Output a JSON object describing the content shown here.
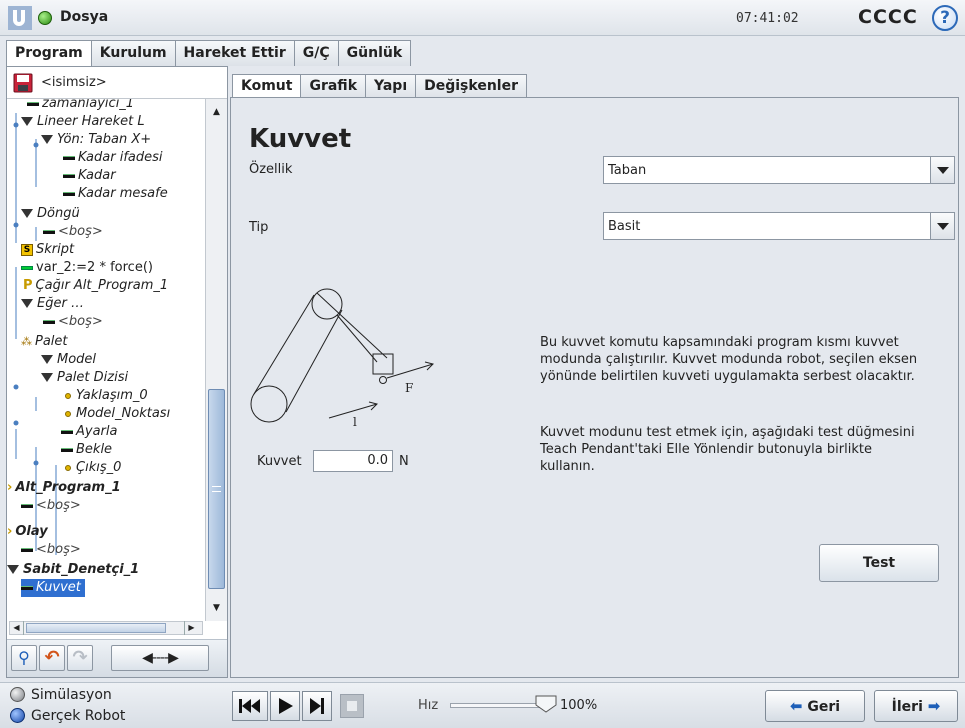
{
  "header": {
    "app_title": "Dosya",
    "clock": "07:41:02",
    "robot_name": "CCCC",
    "help_symbol": "?"
  },
  "main_tabs": [
    {
      "label": "Program",
      "active": true
    },
    {
      "label": "Kurulum",
      "active": false
    },
    {
      "label": "Hareket Ettir",
      "active": false
    },
    {
      "label": "G/Ç",
      "active": false
    },
    {
      "label": "Günlük",
      "active": false
    }
  ],
  "left": {
    "program_name": "<isimsiz>",
    "tree": [
      "zamanlayıcı_1",
      "Lineer Hareket L",
      "Yön: Taban X+",
      "Kadar ifadesi",
      "Kadar",
      "Kadar mesafe",
      "Döngü",
      "<boş>",
      "Skript",
      "var_2:=2 * force()",
      "Çağır Alt_Program_1",
      "Eğer …",
      "<boş>",
      "Palet",
      "Model",
      "Palet Dizisi",
      "Yaklaşım_0",
      "Model_Noktası",
      "Ayarla",
      "Bekle",
      "Çıkış_0",
      "Alt_Program_1",
      "<boş>",
      "Olay",
      "<boş>",
      "Sabit_Denetçi_1",
      "Kuvvet"
    ],
    "selected": "Kuvvet",
    "move_label": "◀----▶"
  },
  "right_tabs": [
    {
      "label": "Komut",
      "active": true
    },
    {
      "label": "Grafik",
      "active": false
    },
    {
      "label": "Yapı",
      "active": false
    },
    {
      "label": "Değişkenler",
      "active": false
    }
  ],
  "command": {
    "title": "Kuvvet",
    "feature_label": "Özellik",
    "feature_value": "Taban",
    "type_label": "Tip",
    "type_value": "Basit",
    "force_label": "Kuvvet",
    "force_value": "0.0",
    "force_unit": "N",
    "diagram_labels": {
      "force": "F",
      "length": "l"
    },
    "description_1": "Bu kuvvet komutu kapsamındaki program kısmı kuvvet modunda çalıştırılır. Kuvvet modunda robot, seçilen eksen yönünde belirtilen kuvveti uygulamakta serbest olacaktır.",
    "description_2": "Kuvvet modunu test etmek için, aşağıdaki test düğmesini Teach Pendant'taki Elle Yönlendir butonuyla birlikte kullanın.",
    "test_label": "Test"
  },
  "footer": {
    "mode_simulation": "Simülasyon",
    "mode_real": "Gerçek Robot",
    "speed_label": "Hız",
    "speed_value": "100%",
    "speed_fraction": 1.0,
    "back_label": "Geri",
    "next_label": "İleri"
  }
}
